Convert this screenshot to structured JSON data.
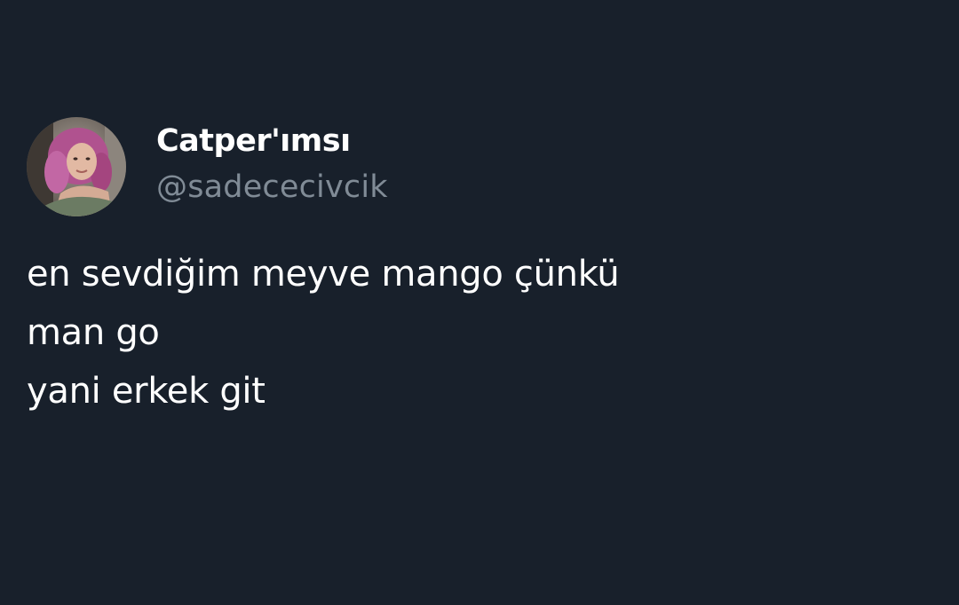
{
  "tweet": {
    "author": {
      "display_name": "Catper'ımsı",
      "handle": "@sadececivcik",
      "avatar_icon": "user-avatar-photo"
    },
    "lines": [
      "en sevdiğim meyve mango çünkü",
      "man go",
      "yani erkek git"
    ]
  },
  "colors": {
    "background": "#18202b",
    "text_primary": "#ffffff",
    "text_secondary": "#808b96"
  }
}
